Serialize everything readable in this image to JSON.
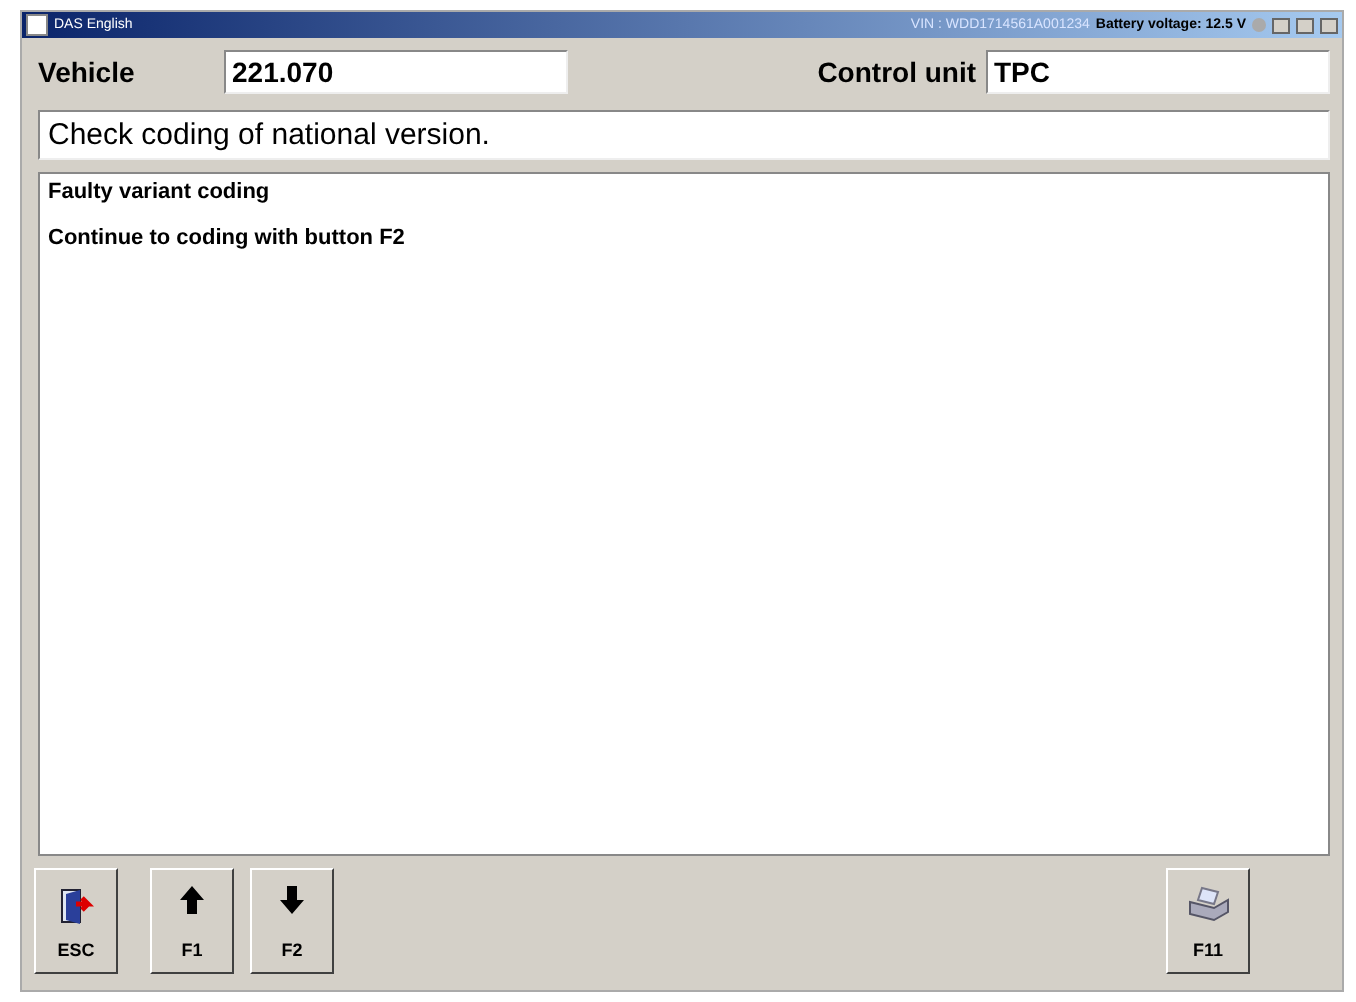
{
  "window": {
    "title": "DAS English",
    "vin": "VIN : WDD1714561A001234",
    "battery": "Battery voltage: 12.5 V"
  },
  "vehicle": {
    "label": "Vehicle",
    "value": "221.070"
  },
  "control_unit": {
    "label": "Control unit",
    "value": "TPC"
  },
  "message": "Check coding of national version.",
  "content": [
    "Faulty variant coding",
    "Continue to coding with button F2"
  ],
  "buttons": [
    {
      "label": "ESC",
      "kind": "exit"
    },
    {
      "label": "F1",
      "kind": "up"
    },
    {
      "label": "F2",
      "kind": "down"
    },
    {
      "label": "F11",
      "kind": "print"
    }
  ]
}
